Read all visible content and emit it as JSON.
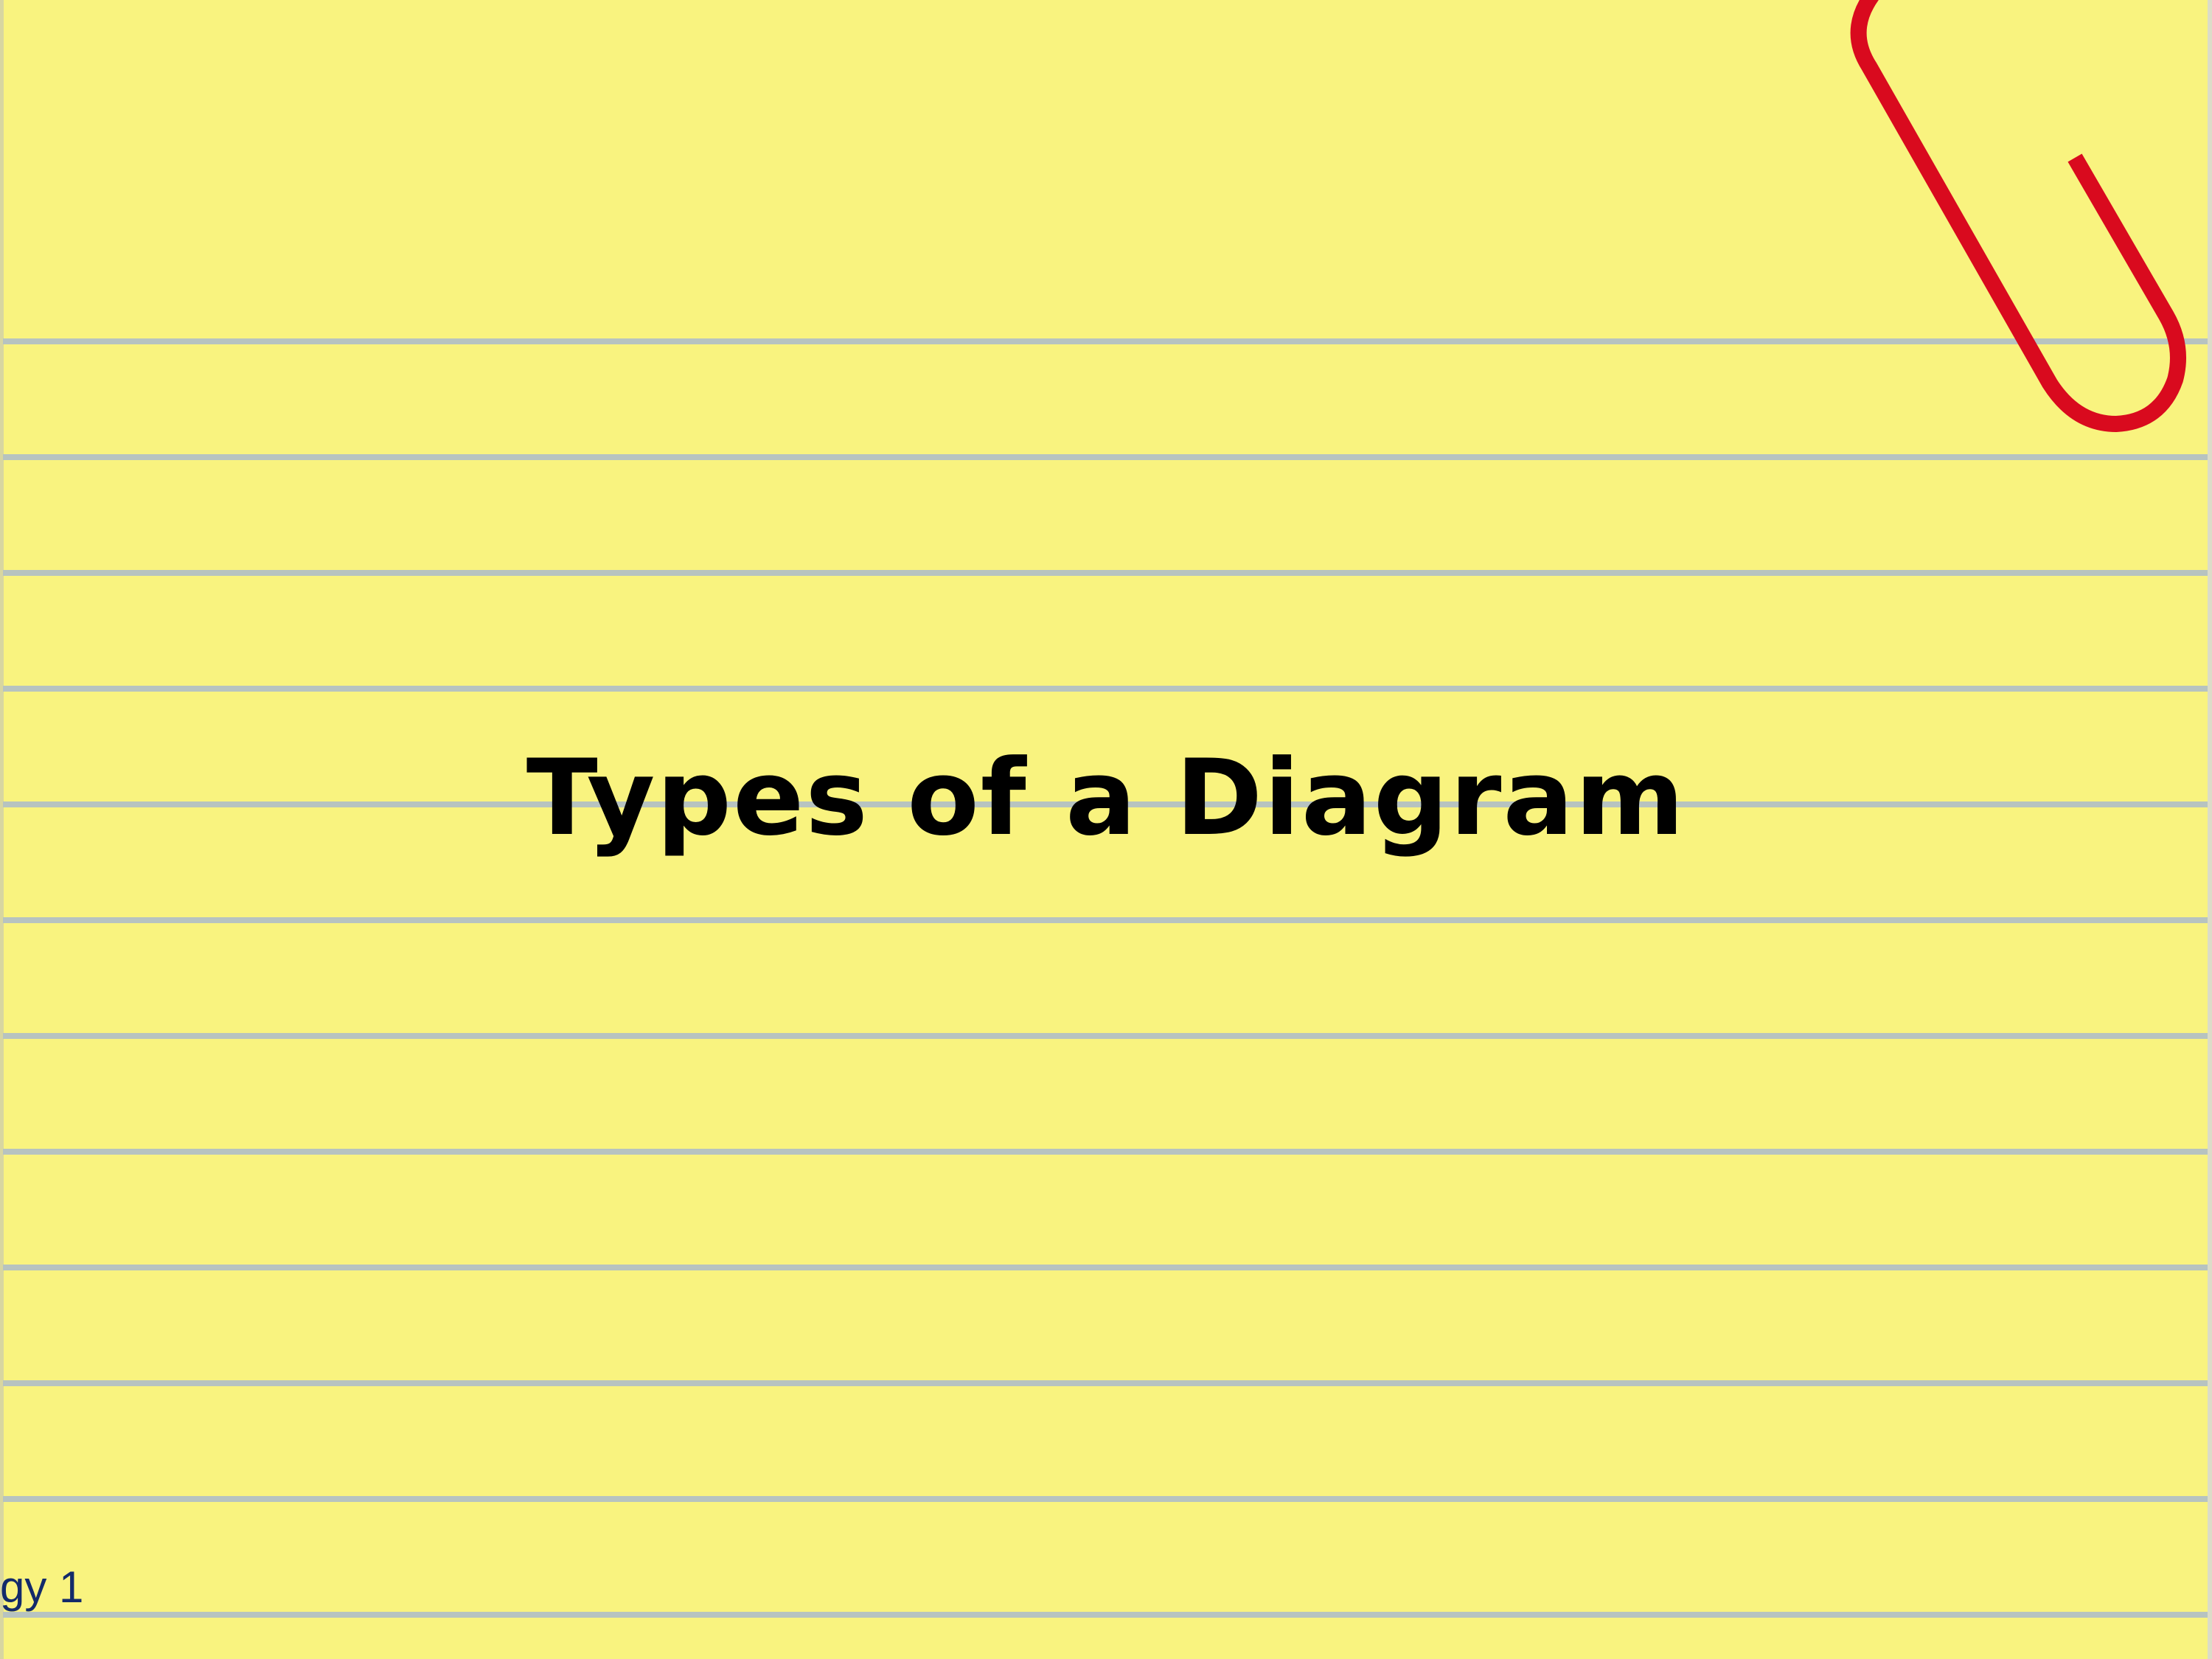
{
  "slide": {
    "title": "Types of a Diagram",
    "footer_text": "gy 1"
  },
  "decoration": {
    "paperclip_icon": "paperclip-icon",
    "paper_color": "#f9f37f",
    "rule_color": "#b7c3c0",
    "clip_color": "#d90a1e"
  }
}
